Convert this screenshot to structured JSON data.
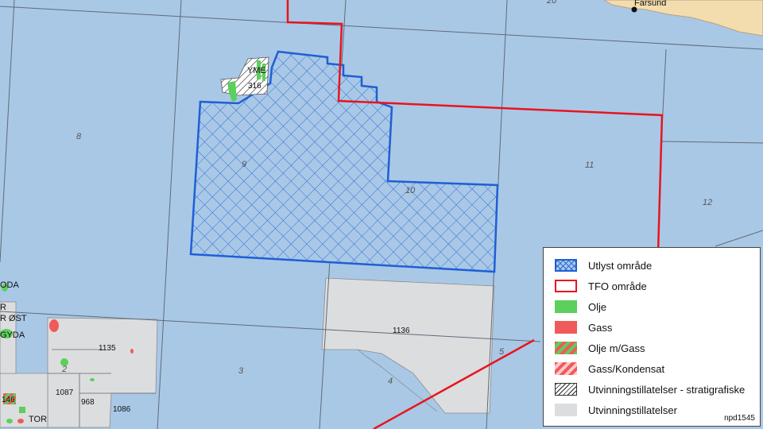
{
  "map": {
    "places": {
      "farsund": "Farsund"
    },
    "quadrants": {
      "q2": "2",
      "q3": "3",
      "q4": "4",
      "q5": "5",
      "q8": "8",
      "q9": "9",
      "q10": "10",
      "q11": "11",
      "q12": "12",
      "q20": "20"
    },
    "licences": {
      "l316": "316",
      "l1135": "1135",
      "l1136": "1136",
      "l1087": "1087",
      "l968": "968",
      "l1086": "1086",
      "l146": "146"
    },
    "fields": {
      "yme": "YME",
      "oda": "ODA",
      "r": "R",
      "r_ost": "R ØST",
      "gyda": "GYDA",
      "tor": "TOR"
    }
  },
  "legend": {
    "items": [
      {
        "label": "Utlyst område",
        "swatch": "crosshatch-blue"
      },
      {
        "label": "TFO område",
        "swatch": "red-outline"
      },
      {
        "label": "Olje",
        "swatch": "green-fill"
      },
      {
        "label": "Gass",
        "swatch": "red-fill"
      },
      {
        "label": "Olje m/Gass",
        "swatch": "green-red-stripes"
      },
      {
        "label": "Gass/Kondensat",
        "swatch": "red-pink-stripes"
      },
      {
        "label": "Utvinningstillatelser - stratigrafiske",
        "swatch": "black-hatch"
      },
      {
        "label": "Utvinningstillatelser",
        "swatch": "grey-fill"
      }
    ],
    "ref": "npd1545"
  },
  "colors": {
    "sea": "#a9c8e6",
    "land": "#f3dcae",
    "announced": "#1f5fd6",
    "tfo": "#e8141e",
    "oil": "#5ccf5c",
    "gas": "#f05a5a",
    "licence": "#dcdddf"
  }
}
